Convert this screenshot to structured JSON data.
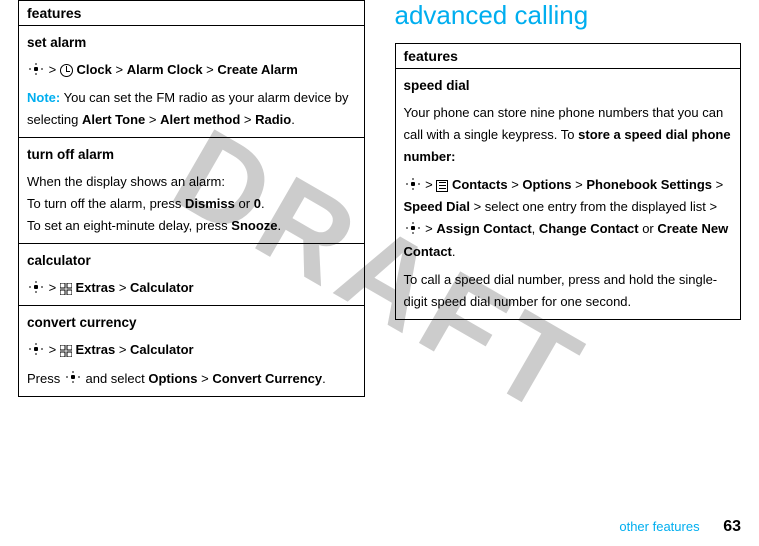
{
  "watermark": "DRAFT",
  "leftTable": {
    "header": "features",
    "setAlarm": {
      "title": "set alarm",
      "clock": "Clock",
      "alarmClock": "Alarm Clock",
      "createAlarm": "Create Alarm",
      "noteLabel": "Note:",
      "noteText": "You can set the FM radio as your alarm device by selecting",
      "alertTone": "Alert Tone",
      "alertMethod": "Alert method",
      "radio": "Radio"
    },
    "turnOffAlarm": {
      "title": "turn off alarm",
      "line1": "When the display shows an alarm:",
      "line2a": "To turn off the alarm, press",
      "dismiss": "Dismiss",
      "or": "or",
      "zerokey": "0",
      "line3a": "To set an eight-minute delay, press",
      "snooze": "Snooze"
    },
    "calculator": {
      "title": "calculator",
      "extras": "Extras",
      "calculator": "Calculator"
    },
    "convertCurrency": {
      "title": "convert currency",
      "extras": "Extras",
      "calculator": "Calculator",
      "pressText": "Press",
      "andSelect": "and select",
      "options": "Options",
      "convert": "Convert Currency"
    }
  },
  "rightCol": {
    "heading": "advanced calling",
    "table": {
      "header": "features",
      "speedDial": {
        "title": "speed dial",
        "intro": "Your phone can store nine phone numbers that you can call with a single keypress. To",
        "storeBold": "store a speed dial phone number:",
        "contacts": "Contacts",
        "options": "Options",
        "phonebookSettings": "Phonebook Settings",
        "speedDial": "Speed Dial",
        "selectText": "> select one entry from the displayed list >",
        "assignContact": "Assign Contact",
        "changeContact": "Change Contact",
        "or": "or",
        "createNewContact": "Create New Contact",
        "callText": "To call a speed dial number, press and hold the single-digit speed dial number for one second."
      }
    }
  },
  "footer": {
    "label": "other features",
    "page": "63"
  }
}
